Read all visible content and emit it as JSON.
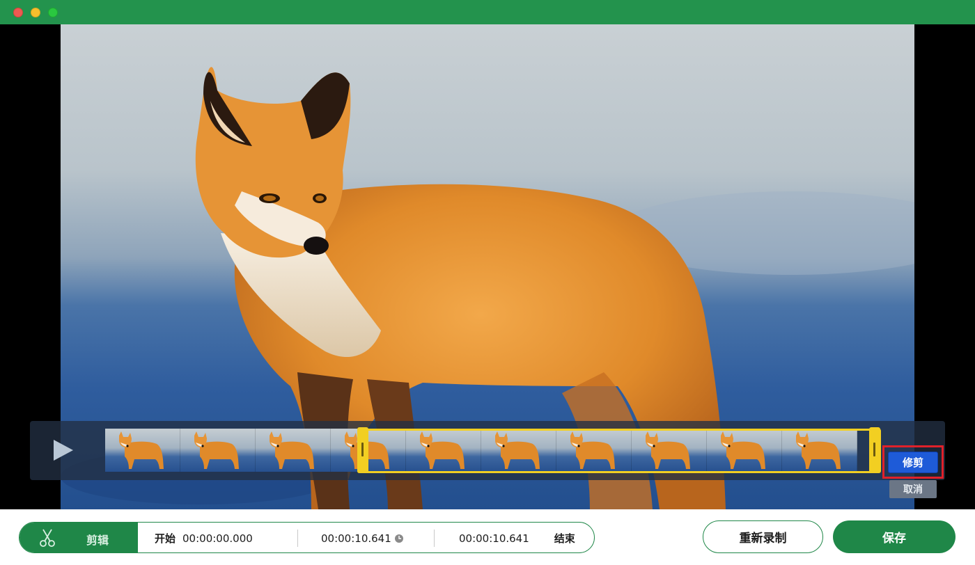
{
  "window": {
    "traffic_lights": [
      "close",
      "minimize",
      "zoom"
    ],
    "titlebar_color": "#23934d"
  },
  "player": {
    "video_subject_image": "red-fox-standing",
    "play_icon": "play-icon",
    "thumbnail_count": 10
  },
  "timeline": {
    "trim_label": "修剪",
    "cancel_label": "取消"
  },
  "bottom": {
    "edit_label": "剪辑",
    "start_label": "开始",
    "start_time": "00:00:00.000",
    "duration_time": "00:00:10.641",
    "end_time": "00:00:10.641",
    "end_label": "结束",
    "rerecord_label": "重新录制",
    "save_label": "保存"
  },
  "colors": {
    "accent_green": "#1f8748",
    "trim_blue": "#1e5bd8",
    "selection_yellow": "#f2cf22",
    "highlight_red": "#e0212a"
  }
}
